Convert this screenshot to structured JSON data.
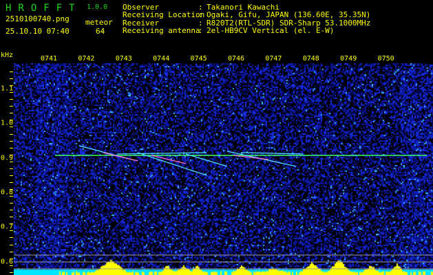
{
  "app": {
    "title": "HROFFT",
    "version": "1.0.0"
  },
  "file": {
    "name": "2510100740.png",
    "datetime": "25.10.10 07:40"
  },
  "meteor": {
    "label": "meteor",
    "count": "64"
  },
  "info": [
    {
      "label": "Observer",
      "value": "Takanori Kawachi"
    },
    {
      "label": "Receiving Location",
      "value": "Ogaki, Gifu, JAPAN (136.60E, 35.35N)"
    },
    {
      "label": "Receiver",
      "value": "R820T2(RTL-SDR) SDR-Sharp 53.1000MHz"
    },
    {
      "label": "Receiving antenna",
      "value": "2el-HB9CV Vertical (el. E-W)"
    }
  ],
  "axis": {
    "freq_unit": "kHz",
    "freq_labels": [
      "1.1",
      "1.0",
      "0.9",
      "0.8",
      "0.7",
      "0.6"
    ],
    "time_labels": [
      "0741",
      "0742",
      "0743",
      "0744",
      "0745",
      "0746",
      "0747",
      "0748",
      "0749",
      "0750"
    ]
  },
  "colors": {
    "header_green": "#19d919",
    "text_yellow": "#ffff00",
    "carrier": "#40ff60",
    "level_cyan": "#00e5ff"
  }
}
